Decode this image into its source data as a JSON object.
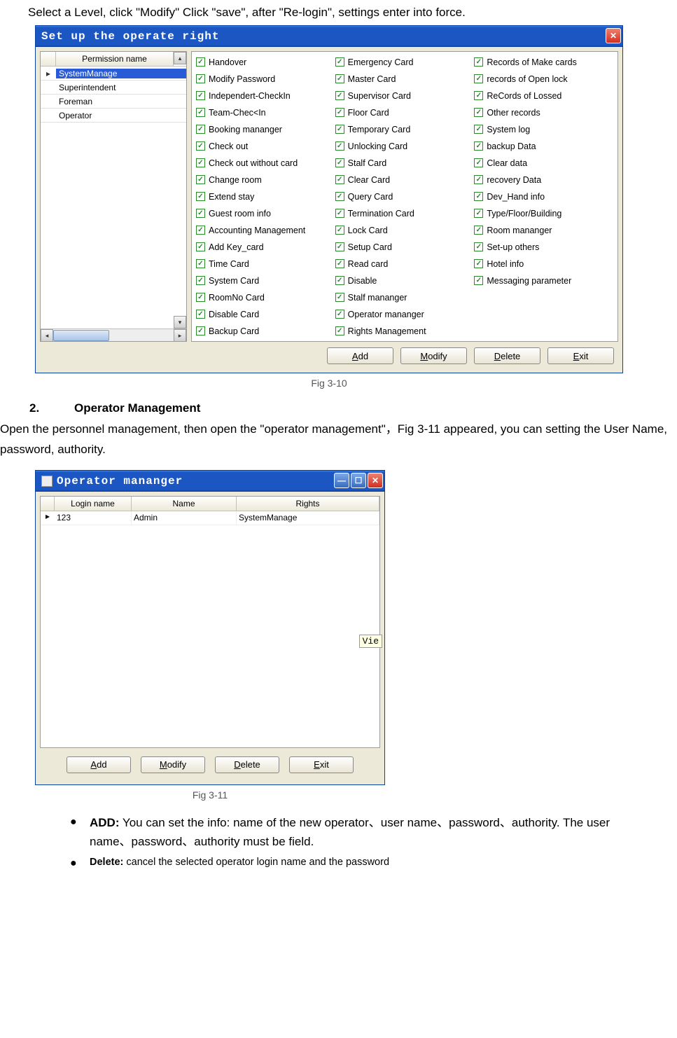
{
  "intro_text": "Select a Level, click \"Modify\" Click \"save\", after \"Re-login\", settings enter into force.",
  "window1": {
    "title": "Set up the operate right",
    "list_header": "Permission name",
    "levels": [
      "SystemManage",
      "Superintendent",
      "Foreman",
      "Operator"
    ],
    "selected_index": 0,
    "permissions_col1": [
      "Handover",
      "Modify Password",
      "Independert-CheckIn",
      "Team-Chec<In",
      "Booking mananger",
      "Check out",
      "Check out without card",
      "Change room",
      "Extend stay",
      "Guest room info",
      "Accounting Management",
      "Add Key_card",
      "Time Card",
      "System Card",
      "RoomNo Card",
      "Disable Card",
      "Backup Card"
    ],
    "permissions_col2": [
      "Emergency Card",
      "Master Card",
      "Supervisor Card",
      "Floor Card",
      "Temporary Card",
      "Unlocking Card",
      "Stalf Card",
      "Clear Card",
      "Query Card",
      "Termination Card",
      "Lock Card",
      "Setup Card",
      "Read card",
      "Disable",
      "Stalf mananger",
      "Operator mananger",
      "Rights Management"
    ],
    "permissions_col3": [
      "Records of Make cards",
      "records of Open lock",
      "ReCords of Lossed",
      "Other records",
      "System log",
      "backup Data",
      "Clear data",
      "recovery Data",
      "Dev_Hand info",
      "Type/Floor/Building",
      "Room mananger",
      "Set-up others",
      "Hotel info",
      "Messaging parameter"
    ],
    "buttons": {
      "add": "Add",
      "modify": "Modify",
      "delete": "Delete",
      "exit": "Exit"
    },
    "caption": "Fig 3-10"
  },
  "section2": {
    "num": "2.",
    "heading": "Operator Management",
    "body": "Open the personnel management, then open the \"operator management\"，Fig 3-11 appeared, you can setting the User Name, password, authority."
  },
  "window2": {
    "title": "Operator mananger",
    "headers": [
      "Login name",
      "Name",
      "Rights"
    ],
    "row": {
      "marker": "▸",
      "login": "123",
      "name": "Admin",
      "rights": "SystemManage"
    },
    "side_tag": "Vie",
    "buttons": {
      "add": "Add",
      "modify": "Modify",
      "delete": "Delete",
      "exit": "Exit"
    },
    "caption": "Fig 3-11"
  },
  "bullets": {
    "b1_bold": "ADD:",
    "b1_text": " You can set the info: name of the new operator、user name、password、authority. The user name、password、authority must be field.",
    "b2_bold": "Delete:",
    "b2_text": " cancel the selected operator login name and the password"
  }
}
